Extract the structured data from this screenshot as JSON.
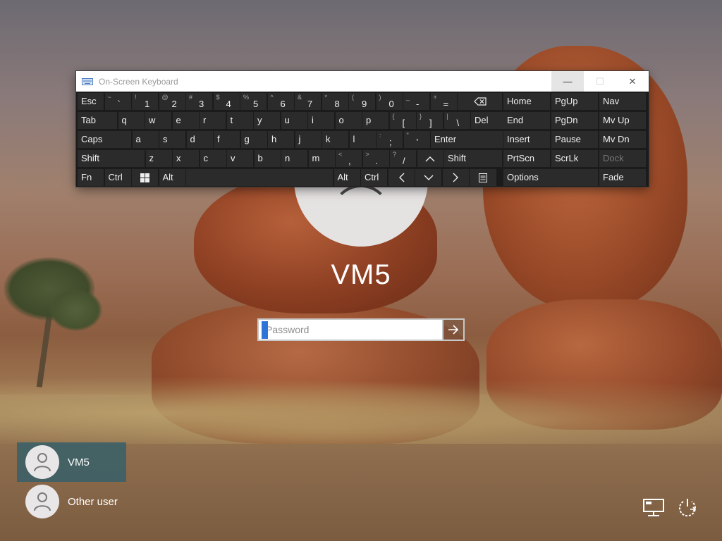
{
  "osk": {
    "title": "On-Screen Keyboard",
    "controls": {
      "minimize": "—",
      "maximize": "☐",
      "close": "✕"
    },
    "rows": [
      [
        {
          "l": "Esc"
        },
        {
          "s": "~",
          "m": "`"
        },
        {
          "s": "!",
          "m": "1"
        },
        {
          "s": "@",
          "m": "2"
        },
        {
          "s": "#",
          "m": "3"
        },
        {
          "s": "$",
          "m": "4"
        },
        {
          "s": "%",
          "m": "5"
        },
        {
          "s": "^",
          "m": "6"
        },
        {
          "s": "&",
          "m": "7"
        },
        {
          "s": "*",
          "m": "8"
        },
        {
          "s": "(",
          "m": "9"
        },
        {
          "s": ")",
          "m": "0"
        },
        {
          "s": "_",
          "m": "-"
        },
        {
          "s": "+",
          "m": "="
        },
        {
          "icon": "backspace"
        }
      ],
      [
        {
          "l": "Tab"
        },
        {
          "l": "q"
        },
        {
          "l": "w"
        },
        {
          "l": "e"
        },
        {
          "l": "r"
        },
        {
          "l": "t"
        },
        {
          "l": "y"
        },
        {
          "l": "u"
        },
        {
          "l": "i"
        },
        {
          "l": "o"
        },
        {
          "l": "p"
        },
        {
          "s": "{",
          "m": "["
        },
        {
          "s": "}",
          "m": "]"
        },
        {
          "s": "|",
          "m": "\\"
        },
        {
          "l": "Del"
        }
      ],
      [
        {
          "l": "Caps"
        },
        {
          "l": "a"
        },
        {
          "l": "s"
        },
        {
          "l": "d"
        },
        {
          "l": "f"
        },
        {
          "l": "g"
        },
        {
          "l": "h"
        },
        {
          "l": "j"
        },
        {
          "l": "k"
        },
        {
          "l": "l"
        },
        {
          "s": ":",
          "m": ";"
        },
        {
          "s": "\"",
          "m": "'"
        },
        {
          "l": "Enter"
        }
      ],
      [
        {
          "l": "Shift"
        },
        {
          "l": "z"
        },
        {
          "l": "x"
        },
        {
          "l": "c"
        },
        {
          "l": "v"
        },
        {
          "l": "b"
        },
        {
          "l": "n"
        },
        {
          "l": "m"
        },
        {
          "s": "<",
          "m": ","
        },
        {
          "s": ">",
          "m": "."
        },
        {
          "s": "?",
          "m": "/"
        },
        {
          "icon": "up"
        },
        {
          "l": "Shift"
        }
      ],
      [
        {
          "l": "Fn"
        },
        {
          "l": "Ctrl"
        },
        {
          "icon": "windows"
        },
        {
          "l": "Alt"
        },
        {
          "l": ""
        },
        {
          "l": "Alt"
        },
        {
          "l": "Ctrl"
        },
        {
          "icon": "left"
        },
        {
          "icon": "down"
        },
        {
          "icon": "right"
        },
        {
          "icon": "menu"
        }
      ]
    ],
    "nav": [
      [
        "Home",
        "PgUp",
        "Nav"
      ],
      [
        "End",
        "PgDn",
        "Mv Up"
      ],
      [
        "Insert",
        "Pause",
        "Mv Dn"
      ],
      [
        "PrtScn",
        "ScrLk",
        "Dock"
      ],
      [
        "Options",
        "Fade"
      ]
    ]
  },
  "login": {
    "username": "VM5",
    "password_placeholder": "Password",
    "submit_icon": "arrow-right-icon"
  },
  "users": [
    {
      "name": "VM5",
      "active": true
    },
    {
      "name": "Other user",
      "active": false
    }
  ],
  "system_icons": [
    "network-icon",
    "power-icon"
  ]
}
